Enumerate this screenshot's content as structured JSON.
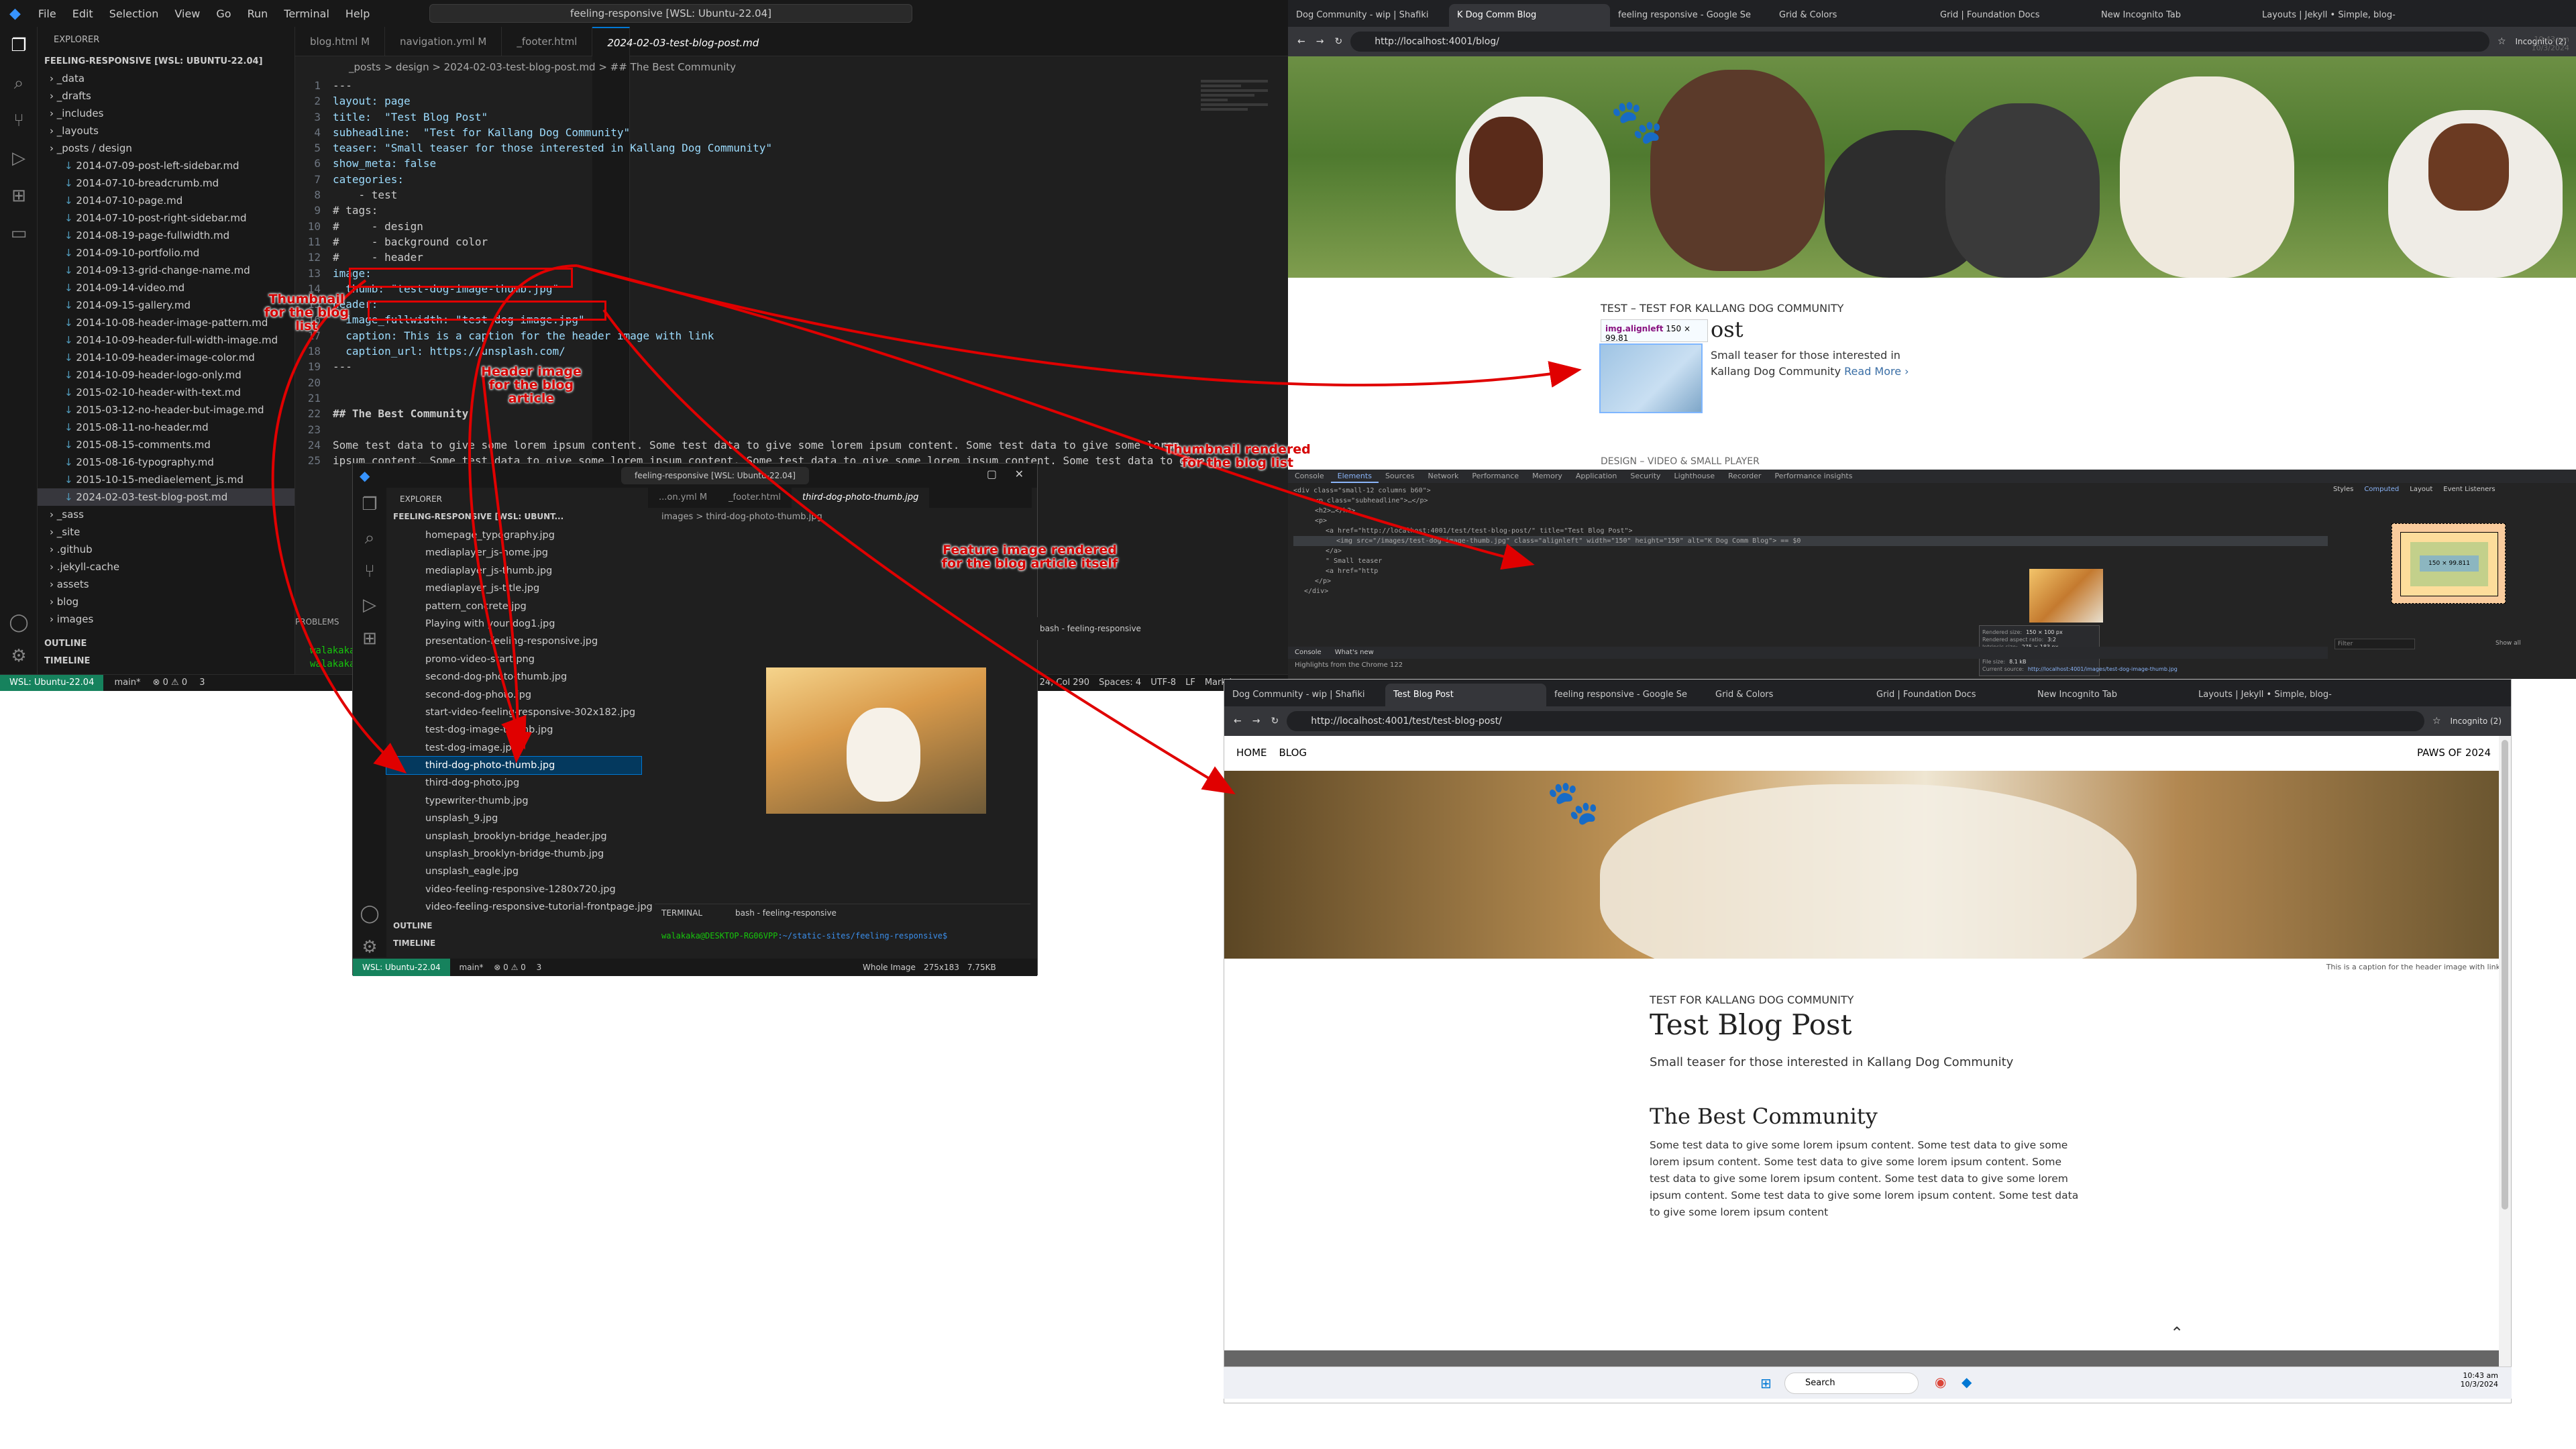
{
  "vscode": {
    "menu": [
      "File",
      "Edit",
      "Selection",
      "View",
      "Go",
      "Run",
      "Terminal",
      "Help"
    ],
    "command_center": "feeling-responsive [WSL: Ubuntu-22.04]",
    "explorer_title": "EXPLORER",
    "root": "FEELING-RESPONSIVE [WSL: UBUNTU-22.04]",
    "tree": [
      "_data",
      "_drafts",
      "_includes",
      "_layouts",
      "_posts / design",
      "2014-07-09-post-left-sidebar.md",
      "2014-07-10-breadcrumb.md",
      "2014-07-10-page.md",
      "2014-07-10-post-right-sidebar.md",
      "2014-08-19-page-fullwidth.md",
      "2014-09-10-portfolio.md",
      "2014-09-13-grid-change-name.md",
      "2014-09-14-video.md",
      "2014-09-15-gallery.md",
      "2014-10-08-header-image-pattern.md",
      "2014-10-09-header-full-width-image.md",
      "2014-10-09-header-image-color.md",
      "2014-10-09-header-logo-only.md",
      "2015-02-10-header-with-text.md",
      "2015-03-12-no-header-but-image.md",
      "2015-08-11-no-header.md",
      "2015-08-15-comments.md",
      "2015-08-16-typography.md",
      "2015-10-15-mediaelement_js.md",
      "2024-02-03-test-blog-post.md",
      "_sass",
      "_site",
      ".github",
      ".jekyll-cache",
      "assets",
      "blog",
      "images"
    ],
    "outline": "OUTLINE",
    "timeline": "TIMELINE",
    "tabs": [
      "blog.html M",
      "navigation.yml M",
      "_footer.html",
      "2024-02-03-test-blog-post.md"
    ],
    "breadcrumb": "_posts > design > 2024-02-03-test-blog-post.md > ## The Best Community",
    "code_lines": [
      "---",
      "layout: page",
      "title:  \"Test Blog Post\"",
      "subheadline:  \"Test for Kallang Dog Community\"",
      "teaser: \"Small teaser for those interested in Kallang Dog Community\"",
      "show_meta: false",
      "categories:",
      "    - test",
      "# tags:",
      "#     - design",
      "#     - background color",
      "#     - header",
      "image:",
      "  thumb: \"test-dog-image-thumb.jpg\"",
      "header:",
      "  image_fullwidth: \"test-dog-image.jpg\"",
      "  caption: This is a caption for the header image with link",
      "  caption_url: https://unsplash.com/",
      "---",
      "",
      "",
      "## The Best Community",
      "",
      "Some test data to give some lorem ipsum content. Some test data to give some lorem ipsum content. Some test data to give some lorem",
      "ipsum content. Some test data to give some lorem ipsum content. Some test data to give some lorem ipsum content. Some test data to give"
    ],
    "panel_label": "PROBLEMS",
    "terminal_user": "walakaka",
    "status_wsl": "WSL: Ubuntu-22.04",
    "status_branch": "main*",
    "status_errors": "⊗ 0 ⚠ 0",
    "status_ports": "3",
    "status_right": [
      "Ln 24, Col 290",
      "Spaces: 4",
      "UTF-8",
      "LF",
      "Markdown"
    ]
  },
  "vscode2": {
    "command_center": "feeling-responsive [WSL: Ubuntu-22.04]",
    "explorer_title": "EXPLORER",
    "root": "FEELING-RESPONSIVE [WSL: UBUNT...",
    "tabs": [
      "...on.yml M",
      "_footer.html",
      "third-dog-photo-thumb.jpg"
    ],
    "breadcrumb": "images > third-dog-photo-thumb.jpg",
    "files": [
      "homepage_typography.jpg",
      "mediaplayer_js-home.jpg",
      "mediaplayer_js-thumb.jpg",
      "mediaplayer_js-title.jpg",
      "pattern_concrete.jpg",
      "Playing with your dog1.jpg",
      "presentation-feeling-responsive.jpg",
      "promo-video-start.png",
      "second-dog-photo-thumb.jpg",
      "second-dog-photo.jpg",
      "start-video-feeling-responsive-302x182.jpg",
      "test-dog-image-thumb.jpg",
      "test-dog-image.jpg",
      "third-dog-photo-thumb.jpg",
      "third-dog-photo.jpg",
      "typewriter-thumb.jpg",
      "unsplash_9.jpg",
      "unsplash_brooklyn-bridge_header.jpg",
      "unsplash_brooklyn-bridge-thumb.jpg",
      "unsplash_eagle.jpg",
      "video-feeling-responsive-1280x720.jpg",
      "video-feeling-responsive-tutorial-frontpage.jpg"
    ],
    "selected_index": 13,
    "outline": "OUTLINE",
    "timeline": "TIMELINE",
    "terminal_tab": "TERMINAL",
    "terminal_shell": "bash - feeling-responsive",
    "prompt_user": "walakaka@DESKTOP-RG06VPP",
    "prompt_path": ":~/static-sites/feeling-responsive$",
    "status_wsl": "WSL: Ubuntu-22.04",
    "status_branch": "main*",
    "status_errors": "⊗ 0 ⚠ 0",
    "status_ports": "3",
    "status_right": [
      "Whole Image",
      "275x183",
      "7.75KB"
    ],
    "small_terminal_shell": "bash - feeling-responsive"
  },
  "chrome1": {
    "tabs": [
      "Dog Community - wip | Shafiki",
      "K Dog Comm Blog",
      "feeling responsive - Google Se",
      "Grid & Colors",
      "Grid | Foundation Docs",
      "New Incognito Tab",
      "Layouts | Jekyll • Simple, blog-"
    ],
    "active_tab": 1,
    "url": "http://localhost:4001/blog/",
    "incognito": "Incognito (2)",
    "post_meta_category": "TEST",
    "post_meta_sub": "– TEST FOR KALLANG DOG COMMUNITY",
    "post_title_fragment": "ost",
    "tooltip_selector": "img.alignleft",
    "tooltip_size": "150 × 99.81",
    "teaser": "Small teaser for those interested in Kallang Dog Community",
    "read_more": "Read More ›",
    "next_meta": "DESIGN – VIDEO & SMALL PLAYER"
  },
  "devtools": {
    "tabs": [
      "Console",
      "Elements",
      "Sources",
      "Network",
      "Performance",
      "Memory",
      "Application",
      "Security",
      "Lighthouse",
      "Recorder",
      "Performance insights"
    ],
    "active_tab": "Elements",
    "side_tabs": [
      "Styles",
      "Computed",
      "Layout",
      "Event Listeners"
    ],
    "dom": [
      "<div class=\"small-12 columns b60\">",
      "<p class=\"subheadline\">…</p>",
      "<h2>…</h2>",
      "<p>",
      "<a href=\"http://localhost:4001/test/test-blog-post/\" title=\"Test Blog Post\">",
      "<img src=\"/images/test-dog-image-thumb.jpg\" class=\"alignleft\" width=\"150\" height=\"150\" alt=\"K Dog Comm Blog\"> == $0",
      "</a>",
      "\" Small teaser",
      "<a href=\"http",
      "</p>",
      "</div>"
    ],
    "popup": [
      [
        "Rendered size:",
        "150 × 100 px"
      ],
      [
        "Rendered aspect ratio:",
        "3:2"
      ],
      [
        "Intrinsic size:",
        "275 × 183 px"
      ],
      [
        "Intrinsic aspect ratio:",
        "275:183"
      ],
      [
        "File size:",
        "8.1 kB"
      ],
      [
        "Current source:",
        "http://localhost:4001/images/test-dog-image-thumb.jpg"
      ]
    ],
    "bottom_tabs": [
      "Console",
      "What's new"
    ],
    "highlight_text": "Highlights from the Chrome 122",
    "box_model_value": "150 × 99.811",
    "filter": "Filter",
    "show_all": "Show all"
  },
  "chrome2": {
    "tabs": [
      "Dog Community - wip | Shafiki",
      "Test Blog Post",
      "feeling responsive - Google Se",
      "Grid & Colors",
      "Grid | Foundation Docs",
      "New Incognito Tab",
      "Layouts | Jekyll • Simple, blog-"
    ],
    "active_tab": 1,
    "url": "http://localhost:4001/test/test-blog-post/",
    "incognito": "Incognito (2)",
    "nav": [
      "HOME",
      "BLOG"
    ],
    "nav_right": "PAWS OF 2024",
    "caption": "This is a caption for the header image with link",
    "subheadline": "TEST FOR KALLANG DOG COMMUNITY",
    "title": "Test Blog Post",
    "teaser": "Small teaser for those interested in Kallang Dog Community",
    "section_heading": "The Best Community",
    "body": "Some test data to give some lorem ipsum content. Some test data to give some lorem ipsum content. Some test data to give some lorem ipsum content. Some test data to give some lorem ipsum content. Some test data to give some lorem ipsum content. Some test data to give some lorem ipsum content. Some test data to give some lorem ipsum content",
    "scroll_top": "⌃"
  },
  "taskbar": {
    "search": "Search",
    "time": "10:43 am",
    "date": "10/3/2024"
  },
  "clock1": {
    "time": "10:43 am",
    "date": "10/3/2024"
  },
  "annotations": {
    "thumb_label": "Thumbnail for the blog list",
    "header_label": "Header image for the blog article",
    "thumb_rendered": "Thumbnail rendered for the blog list",
    "feature_rendered": "Feature image rendered for the blog article itself"
  },
  "colors": {
    "annotation": "#e00000",
    "vscode_bg": "#1f1f1f",
    "wsl_badge": "#16825d"
  }
}
